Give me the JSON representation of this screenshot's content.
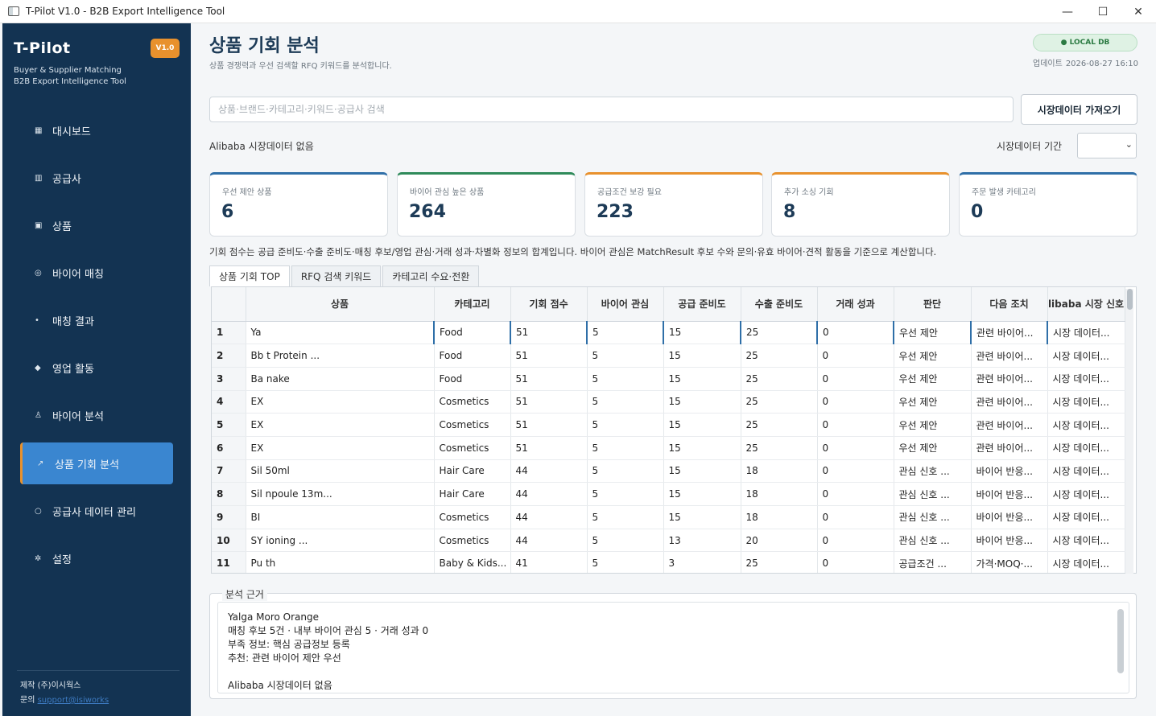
{
  "window": {
    "title": "T-Pilot V1.0 - B2B Export Intelligence Tool"
  },
  "sidebar": {
    "brand": "T-Pilot",
    "version": "V1.0",
    "subtitle_1": "Buyer & Supplier Matching",
    "subtitle_2": "B2B Export Intelligence Tool",
    "items": [
      {
        "icon": "dashboard-icon",
        "glyph": "▦",
        "label": "대시보드"
      },
      {
        "icon": "supplier-icon",
        "glyph": "▥",
        "label": "공급사"
      },
      {
        "icon": "product-icon",
        "glyph": "▣",
        "label": "상품"
      },
      {
        "icon": "target-icon",
        "glyph": "◎",
        "label": "바이어 매칭"
      },
      {
        "icon": "dot-icon",
        "glyph": "•",
        "label": "매칭 결과"
      },
      {
        "icon": "diamond-icon",
        "glyph": "◆",
        "label": "영업 활동"
      },
      {
        "icon": "person-icon",
        "glyph": "♙",
        "label": "바이어 분석"
      },
      {
        "icon": "trend-icon",
        "glyph": "↗",
        "label": "상품 기회 분석"
      },
      {
        "icon": "data-icon",
        "glyph": "○",
        "label": "공급사 데이터 관리"
      },
      {
        "icon": "gear-icon",
        "glyph": "✲",
        "label": "설정"
      }
    ],
    "footer_company": "제작 (주)이시웍스",
    "footer_contact_label": "문의",
    "footer_contact_link": "support@isiworks"
  },
  "header": {
    "title": "상품 기회 분석",
    "description": "상품 경쟁력과 우선 검색할 RFQ 키워드를 분석합니다.",
    "db_badge": "● LOCAL DB",
    "update_label": "업데이트",
    "update_time": "2026-08-27 16:10"
  },
  "search": {
    "placeholder": "상품·브랜드·카테고리·키워드·공급사 검색",
    "fetch_button": "시장데이터 가져오기",
    "market_status": "Alibaba 시장데이터 없음",
    "period_label": "시장데이터 기간",
    "period_value": ""
  },
  "kpis": [
    {
      "label": "우선 제안 상품",
      "value": "6",
      "color": "#2f6fa8"
    },
    {
      "label": "바이어 관심 높은 상품",
      "value": "264",
      "color": "#2f8a5a"
    },
    {
      "label": "공급조건 보강 필요",
      "value": "223",
      "color": "#e8912d"
    },
    {
      "label": "추가 소싱 기회",
      "value": "8",
      "color": "#e8912d"
    },
    {
      "label": "주문 발생 카테고리",
      "value": "0",
      "color": "#2f6fa8"
    }
  ],
  "note": "기회 점수는 공급 준비도·수출 준비도·매칭 후보/영업 관심·거래 성과·차별화 정보의 합계입니다. 바이어 관심은 MatchResult 후보 수와 문의·유효 바이어·견적 활동을 기준으로 계산합니다.",
  "tabs": [
    "상품 기회 TOP",
    "RFQ 검색 키워드",
    "카테고리 수요·전환"
  ],
  "table": {
    "columns": [
      "",
      "상품",
      "카테고리",
      "기회 점수",
      "바이어 관심",
      "공급 준비도",
      "수출 준비도",
      "거래 성과",
      "판단",
      "다음 조치",
      "libaba 시장 신호"
    ],
    "rows": [
      [
        "1",
        "Ya",
        "Food",
        "51",
        "5",
        "15",
        "25",
        "0",
        "우선 제안",
        "관련 바이어...",
        "시장 데이터..."
      ],
      [
        "2",
        "Bb                         t Protein ...",
        "Food",
        "51",
        "5",
        "15",
        "25",
        "0",
        "우선 제안",
        "관련 바이어...",
        "시장 데이터..."
      ],
      [
        "3",
        "Ba                         nake",
        "Food",
        "51",
        "5",
        "15",
        "25",
        "0",
        "우선 제안",
        "관련 바이어...",
        "시장 데이터..."
      ],
      [
        "4",
        "EX",
        "Cosmetics",
        "51",
        "5",
        "15",
        "25",
        "0",
        "우선 제안",
        "관련 바이어...",
        "시장 데이터..."
      ],
      [
        "5",
        "EX",
        "Cosmetics",
        "51",
        "5",
        "15",
        "25",
        "0",
        "우선 제안",
        "관련 바이어...",
        "시장 데이터..."
      ],
      [
        "6",
        "EX",
        "Cosmetics",
        "51",
        "5",
        "15",
        "25",
        "0",
        "우선 제안",
        "관련 바이어...",
        "시장 데이터..."
      ],
      [
        "7",
        "Sil                        50ml",
        "Hair Care",
        "44",
        "5",
        "15",
        "18",
        "0",
        "관심 신호 ...",
        "바이어 반응...",
        "시장 데이터..."
      ],
      [
        "8",
        "Sil                        npoule 13m...",
        "Hair Care",
        "44",
        "5",
        "15",
        "18",
        "0",
        "관심 신호 ...",
        "바이어 반응...",
        "시장 데이터..."
      ],
      [
        "9",
        "BI",
        "Cosmetics",
        "44",
        "5",
        "15",
        "18",
        "0",
        "관심 신호 ...",
        "바이어 반응...",
        "시장 데이터..."
      ],
      [
        "10",
        "SY                        ioning ...",
        "Cosmetics",
        "44",
        "5",
        "13",
        "20",
        "0",
        "관심 신호 ...",
        "바이어 반응...",
        "시장 데이터..."
      ],
      [
        "11",
        "Pu                        th",
        "Baby & Kids...",
        "41",
        "5",
        "3",
        "25",
        "0",
        "공급조건 ...",
        "가격·MOQ·...",
        "시장 데이터..."
      ]
    ]
  },
  "analysis": {
    "title": "분석 근거",
    "lines": [
      "Yalga Moro Orange",
      "매칭 후보 5건 · 내부 바이어 관심 5 · 거래 성과 0",
      "부족 정보: 핵심 공급정보 등록",
      "추천: 관련 바이어 제안 우선",
      "",
      "Alibaba 시장데이터 없음"
    ]
  }
}
